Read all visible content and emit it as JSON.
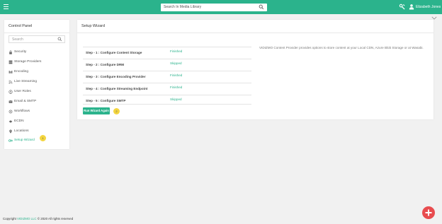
{
  "topbar": {
    "search_placeholder": "Search In Media Library",
    "user_name": "Elizabeth Jones"
  },
  "control_panel": {
    "title": "Control Panel",
    "search_placeholder": "Search",
    "items": [
      {
        "label": "Security",
        "icon": "lock-icon"
      },
      {
        "label": "Storage Providers",
        "icon": "storage-icon"
      },
      {
        "label": "Encoding",
        "icon": "encoding-icon"
      },
      {
        "label": "Live Streaming",
        "icon": "rss-icon"
      },
      {
        "label": "User Roles",
        "icon": "user-roles-icon"
      },
      {
        "label": "Email & SMTP",
        "icon": "email-icon"
      },
      {
        "label": "Workflows",
        "icon": "workflow-icon"
      },
      {
        "label": "ECDN",
        "icon": "ecdn-icon"
      },
      {
        "label": "Locations",
        "icon": "location-icon"
      },
      {
        "label": "Setup Wizard",
        "icon": "wizard-icon"
      }
    ],
    "badge": "1"
  },
  "wizard": {
    "title": "Setup Wizard",
    "steps": [
      {
        "name": "Step - 1 : Configure Content Storage",
        "status": "Finished"
      },
      {
        "name": "Step - 2 : Configure DRM",
        "status": "Skipped"
      },
      {
        "name": "Step - 3 : Configure Encoding Provider",
        "status": "Finished"
      },
      {
        "name": "Step - 4 : Configure Streaming Endpoint",
        "status": "Finished"
      },
      {
        "name": "Step - 5 : Configure SMTP",
        "status": "Skipped"
      }
    ],
    "description": "VIDIZMO Content Provider provides options to store content at your Local CDN, Azure Blob Storage or at Wasabi.",
    "run_button": "Run Wizard Again",
    "badge": "2"
  },
  "footer": {
    "prefix": "Copyright",
    "company": "VIDIZMO LLC",
    "suffix": "© 2020 All rights reserved"
  },
  "colors": {
    "accent": "#2bb38c",
    "fab": "#e84c4f",
    "badge": "#f3d53f"
  }
}
